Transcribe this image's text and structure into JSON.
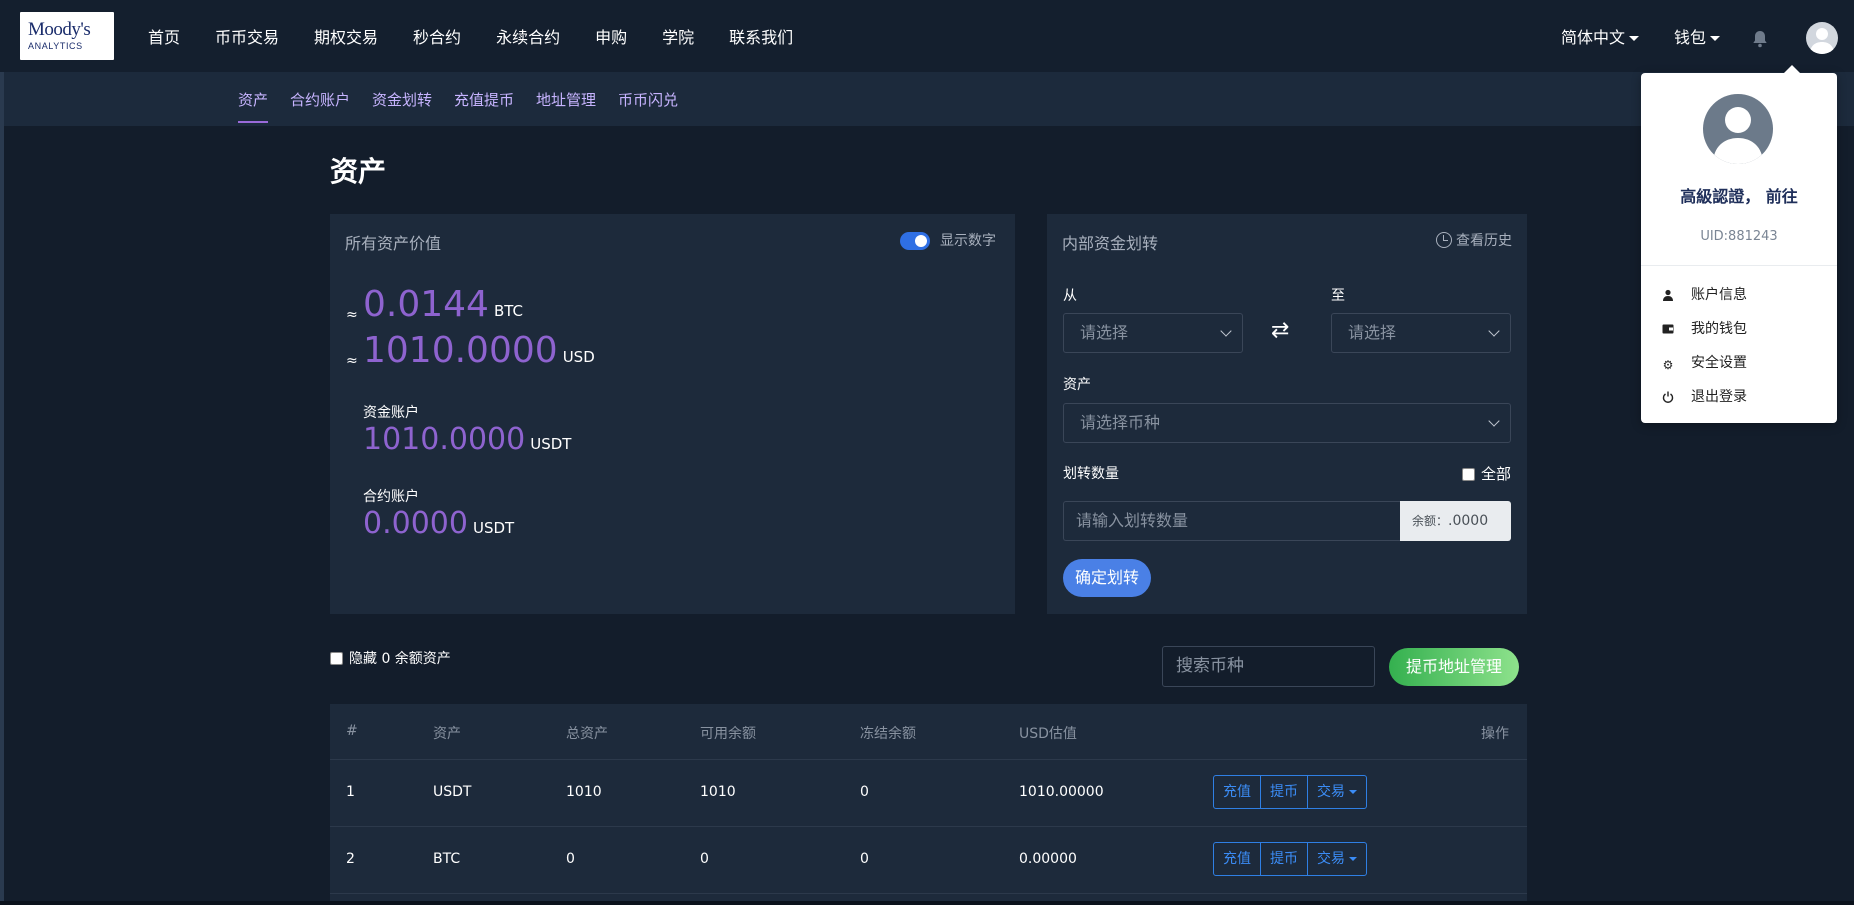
{
  "brand": {
    "line1": "Moody's",
    "line2": "ANALYTICS"
  },
  "nav": {
    "items": [
      "首页",
      "币币交易",
      "期权交易",
      "秒合约",
      "永续合约",
      "申购",
      "学院",
      "联系我们"
    ],
    "language": "简体中文",
    "wallet": "钱包"
  },
  "subnav": {
    "items": [
      "资产",
      "合约账户",
      "资金划转",
      "充值提币",
      "地址管理",
      "币币闪兑"
    ],
    "active": "资产"
  },
  "page": {
    "title": "资产"
  },
  "assets_card": {
    "title": "所有资产价值",
    "toggle_label": "显示数字",
    "toggle_on": true,
    "approx_symbol": "≈",
    "btc_value": "0.0144",
    "btc_unit": "BTC",
    "usd_value": "1010.0000",
    "usd_unit": "USD",
    "fund_account_label": "资金账户",
    "fund_account_value": "1010.0000",
    "fund_account_unit": "USDT",
    "contract_account_label": "合约账户",
    "contract_account_value": "0.0000",
    "contract_account_unit": "USDT"
  },
  "transfer_card": {
    "title": "内部资金划转",
    "history_label": "查看历史",
    "from_label": "从",
    "to_label": "至",
    "from_placeholder": "请选择",
    "to_placeholder": "请选择",
    "swap_glyph": "⇄",
    "asset_label": "资产",
    "asset_placeholder": "请选择币种",
    "amount_label": "划转数量",
    "all_label": "全部",
    "amount_placeholder": "请输入划转数量",
    "balance_label": "余额：",
    "balance_value": ".0000",
    "confirm_button": "确定划转"
  },
  "filters": {
    "hide_zero_label": "隐藏 0 余额资产",
    "search_placeholder": "搜索币种",
    "address_button": "提币地址管理"
  },
  "table": {
    "headers": [
      "#",
      "资产",
      "总资产",
      "可用余额",
      "冻结余额",
      "USD估值",
      "操作"
    ],
    "rows": [
      {
        "idx": "1",
        "asset": "USDT",
        "total": "1010",
        "available": "1010",
        "frozen": "0",
        "usd": "1010.00000"
      },
      {
        "idx": "2",
        "asset": "BTC",
        "total": "0",
        "available": "0",
        "frozen": "0",
        "usd": "0.00000"
      }
    ],
    "actions": {
      "deposit": "充值",
      "withdraw": "提币",
      "trade": "交易"
    }
  },
  "user_dropdown": {
    "cert_label": "高級認證， 前往",
    "uid": "UID:881243",
    "items": [
      "账户信息",
      "我的钱包",
      "安全设置",
      "退出登录"
    ]
  },
  "colors": {
    "background": "#131d2b",
    "card": "#1d2a3b",
    "accent_purple": "#8e63cf",
    "primary_blue": "#2f7fe4",
    "green_button": "#34b04f"
  }
}
